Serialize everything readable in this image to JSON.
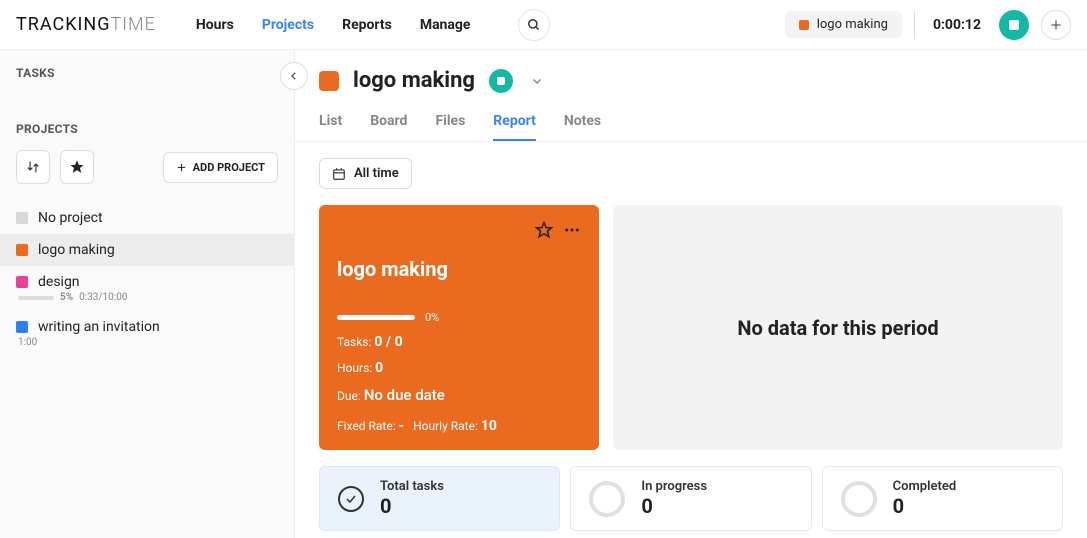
{
  "logo": {
    "part1": "TRACKING",
    "part2": "TIME"
  },
  "nav": {
    "hours": "Hours",
    "projects": "Projects",
    "reports": "Reports",
    "manage": "Manage"
  },
  "timer": {
    "project_color": "#ea6a20",
    "project_name": "logo making",
    "elapsed": "0:00:12"
  },
  "sidebar": {
    "tasks_heading": "TASKS",
    "projects_heading": "PROJECTS",
    "add_project_label": "ADD PROJECT",
    "items": [
      {
        "name": "No project",
        "color": "#d8d8d8"
      },
      {
        "name": "logo making",
        "color": "#ea6a20",
        "active": true
      },
      {
        "name": "design",
        "color": "#e64398",
        "progress_pct": "5%",
        "progress_detail": "0:33/10:00",
        "progress_fill": 5
      },
      {
        "name": "writing an invitation",
        "color": "#2f80ed",
        "sub": "1:00"
      }
    ]
  },
  "project_header": {
    "color": "#ea6a20",
    "title": "logo making"
  },
  "tabs": {
    "list": "List",
    "board": "Board",
    "files": "Files",
    "report": "Report",
    "notes": "Notes"
  },
  "range": {
    "label": "All time"
  },
  "card": {
    "title": "logo making",
    "progress_pct": "0%",
    "tasks_label": "Tasks:",
    "tasks_value": "0 / 0",
    "hours_label": "Hours:",
    "hours_value": "0",
    "due_label": "Due:",
    "due_value": "No due date",
    "fixed_rate_label": "Fixed Rate:",
    "fixed_rate_value": "-",
    "hourly_rate_label": "Hourly Rate:",
    "hourly_rate_value": "10"
  },
  "chart": {
    "empty": "No data for this period"
  },
  "stats": {
    "total_label": "Total tasks",
    "total_value": "0",
    "inprogress_label": "In progress",
    "inprogress_value": "0",
    "completed_label": "Completed",
    "completed_value": "0"
  }
}
